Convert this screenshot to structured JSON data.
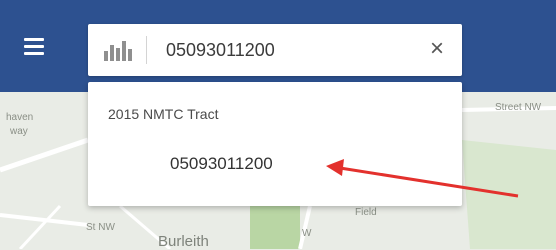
{
  "header": {
    "menu_icon": "hamburger-icon",
    "background": "#2d5190"
  },
  "search": {
    "icon": "bar-chart-icon",
    "value": "05093011200",
    "clear_icon": "close-icon",
    "clear_glyph": "×"
  },
  "dropdown": {
    "group_title": "2015 NMTC Tract",
    "results": [
      "05093011200"
    ]
  },
  "map": {
    "labels": {
      "haven": "haven",
      "way": "way",
      "street_nw": "Street NW",
      "st_nw": "St NW",
      "field": "Field",
      "burleith": "Burleith",
      "w": "W"
    }
  },
  "annotation": {
    "arrow_color": "#e3312d"
  }
}
